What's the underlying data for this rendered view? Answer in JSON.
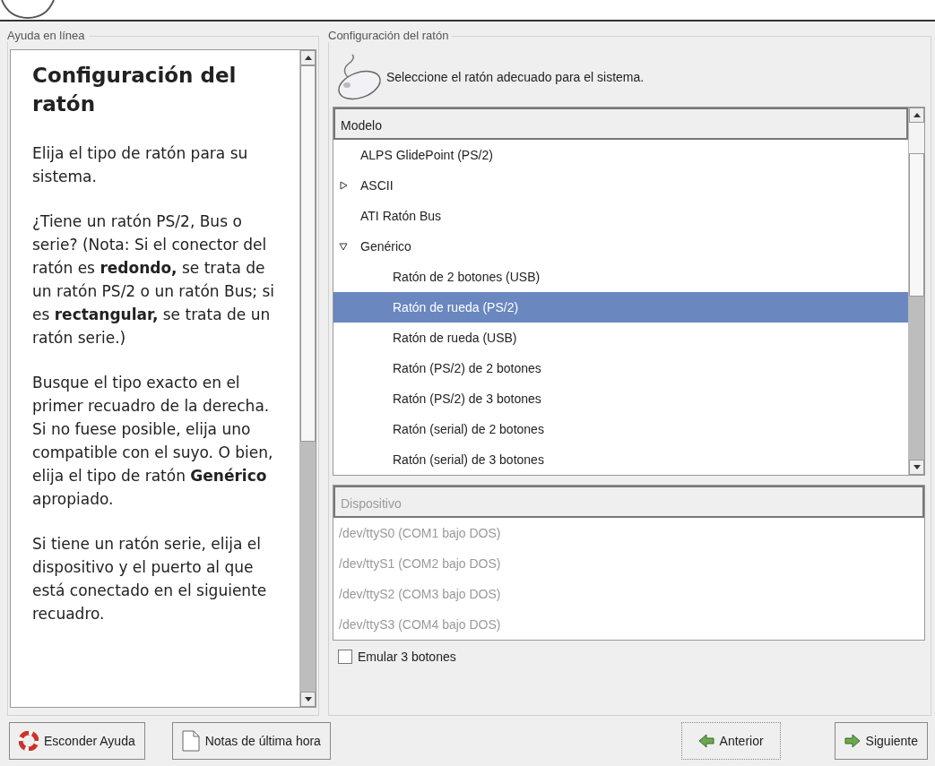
{
  "help_panel": {
    "legend": "Ayuda en línea",
    "title": "Configuración del ratón",
    "paragraphs": [
      "Elija el tipo de ratón para su sistema.",
      "¿Tiene un ratón PS/2, Bus o serie? (Nota: Si el conector del ratón es **redondo,** se trata de un ratón PS/2 o un ratón Bus; si es **rectangular,** se trata de un ratón serie.)",
      "Busque el tipo exacto en el primer recuadro de la derecha. Si no fuese posible, elija uno compatible con el suyo. O bien, elija el tipo de ratón **Genérico** apropiado.",
      "Si tiene un ratón serie, elija el dispositivo y el puerto al que está conectado en el siguiente recuadro."
    ]
  },
  "mouse_panel": {
    "legend": "Configuración del ratón",
    "instruction": "Seleccione el ratón adecuado para el sistema.",
    "model_list": {
      "header": "Modelo",
      "rows": [
        {
          "label": "ALPS GlidePoint (PS/2)",
          "selected": false
        },
        {
          "label": "ASCII",
          "selected": false,
          "expanded": false
        },
        {
          "label": "ATI Ratón Bus",
          "selected": false
        },
        {
          "label": "Genérico",
          "selected": false,
          "expanded": true,
          "children": [
            {
              "label": "Ratón de 2 botones (USB)",
              "selected": false
            },
            {
              "label": "Ratón de rueda (PS/2)",
              "selected": true
            },
            {
              "label": "Ratón de rueda (USB)",
              "selected": false
            },
            {
              "label": "Ratón (PS/2) de 2 botones",
              "selected": false
            },
            {
              "label": "Ratón (PS/2) de 3 botones",
              "selected": false
            },
            {
              "label": "Ratón (serial) de 2 botones",
              "selected": false
            },
            {
              "label": "Ratón (serial) de 3 botones",
              "selected": false
            }
          ]
        }
      ]
    },
    "device_list": {
      "header": "Dispositivo",
      "disabled": true,
      "rows": [
        "/dev/ttyS0 (COM1 bajo DOS)",
        "/dev/ttyS1 (COM2 bajo DOS)",
        "/dev/ttyS2 (COM3 bajo DOS)",
        "/dev/ttyS3 (COM4 bajo DOS)"
      ]
    },
    "emulate_checkbox": {
      "label": "Emular 3 botones",
      "checked": false
    }
  },
  "buttons": [
    {
      "label": "Esconder Ayuda",
      "kind": "help"
    },
    {
      "label": "Notas de última hora",
      "kind": "notes"
    },
    {
      "label": "Anterior",
      "kind": "back"
    },
    {
      "label": "Siguiente",
      "kind": "next"
    }
  ]
}
